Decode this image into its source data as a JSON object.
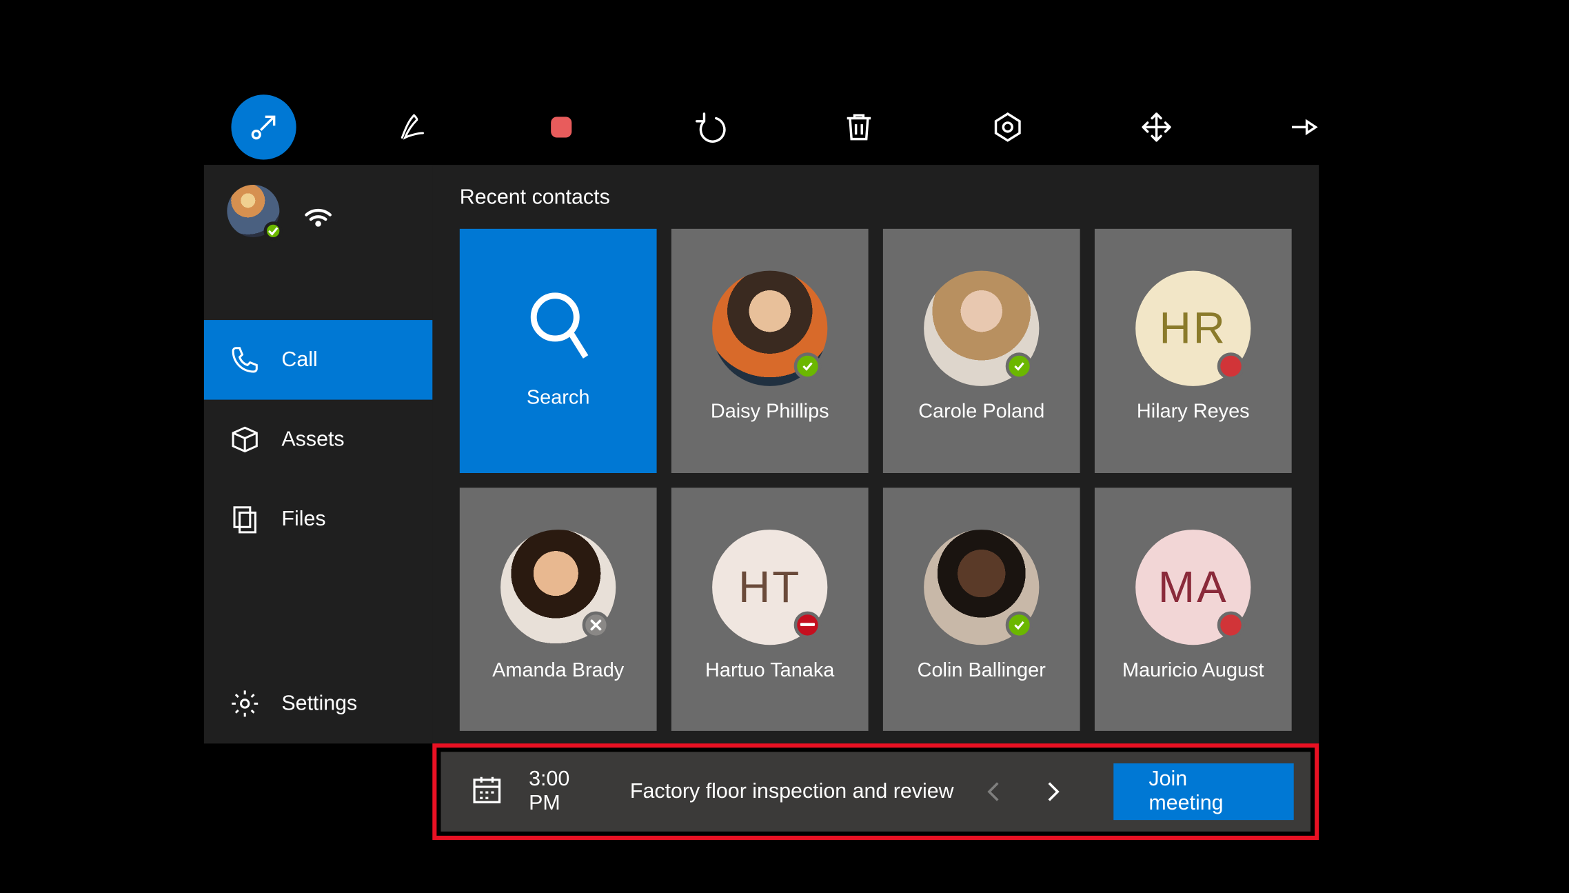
{
  "toolbar": {
    "items": [
      {
        "name": "minimize-icon",
        "active": true
      },
      {
        "name": "pen-icon"
      },
      {
        "name": "record-icon"
      },
      {
        "name": "undo-icon"
      },
      {
        "name": "trash-icon"
      },
      {
        "name": "target-icon"
      },
      {
        "name": "move-icon"
      },
      {
        "name": "pin-icon"
      }
    ]
  },
  "sidebar": {
    "items": [
      {
        "label": "Call",
        "icon": "phone-icon",
        "active": true
      },
      {
        "label": "Assets",
        "icon": "package-icon"
      },
      {
        "label": "Files",
        "icon": "files-icon"
      }
    ],
    "settings_label": "Settings"
  },
  "main": {
    "section_title": "Recent contacts",
    "search_label": "Search",
    "contacts": [
      {
        "name": "Daisy Phillips",
        "photo": "photo-daisy",
        "status": "available"
      },
      {
        "name": "Carole Poland",
        "photo": "photo-carole",
        "status": "available"
      },
      {
        "name": "Hilary Reyes",
        "mono": "HR",
        "mono_cls": "mono-hr",
        "status": "busy"
      },
      {
        "name": "Amanda Brady",
        "photo": "photo-amanda",
        "status": "offline"
      },
      {
        "name": "Hartuo Tanaka",
        "mono": "HT",
        "mono_cls": "mono-ht",
        "status": "dnd"
      },
      {
        "name": "Colin Ballinger",
        "photo": "photo-colin",
        "status": "available"
      },
      {
        "name": "Mauricio August",
        "mono": "MA",
        "mono_cls": "mono-ma",
        "status": "busy"
      }
    ]
  },
  "meeting": {
    "time": "3:00 PM",
    "title": "Factory floor inspection and review",
    "join_label": "Join meeting"
  }
}
